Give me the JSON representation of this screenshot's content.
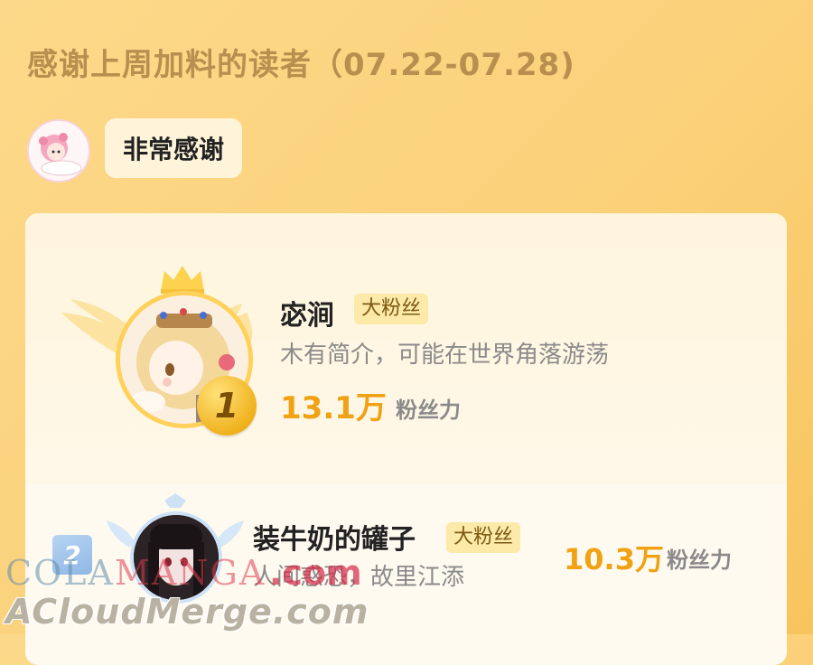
{
  "header": {
    "title": "感谢上周加料的读者（07.22-07.28)"
  },
  "message": {
    "text": "非常感谢"
  },
  "ranking": [
    {
      "rank": "1",
      "name": "宓涧",
      "tag": "大粉丝",
      "bio": "木有简介，可能在世界角落游荡",
      "count": "13.1万",
      "unit": "粉丝力"
    },
    {
      "rank": "2",
      "name": "装牛奶的罐子",
      "tag": "大粉丝",
      "bio": "人间惑恐，故里江添",
      "count": "10.3万",
      "unit": "粉丝力"
    }
  ],
  "watermarks": {
    "line1_a": "COLA",
    "line1_b": "MANGA",
    "line1_c": ".com",
    "line2": "ACloudMerge.com"
  },
  "colors": {
    "background": "#fbd17a",
    "title": "#b88f4e",
    "accent": "#f0a214",
    "gold_badge": "#f0b21e",
    "silver_badge": "#8fb7e6"
  }
}
